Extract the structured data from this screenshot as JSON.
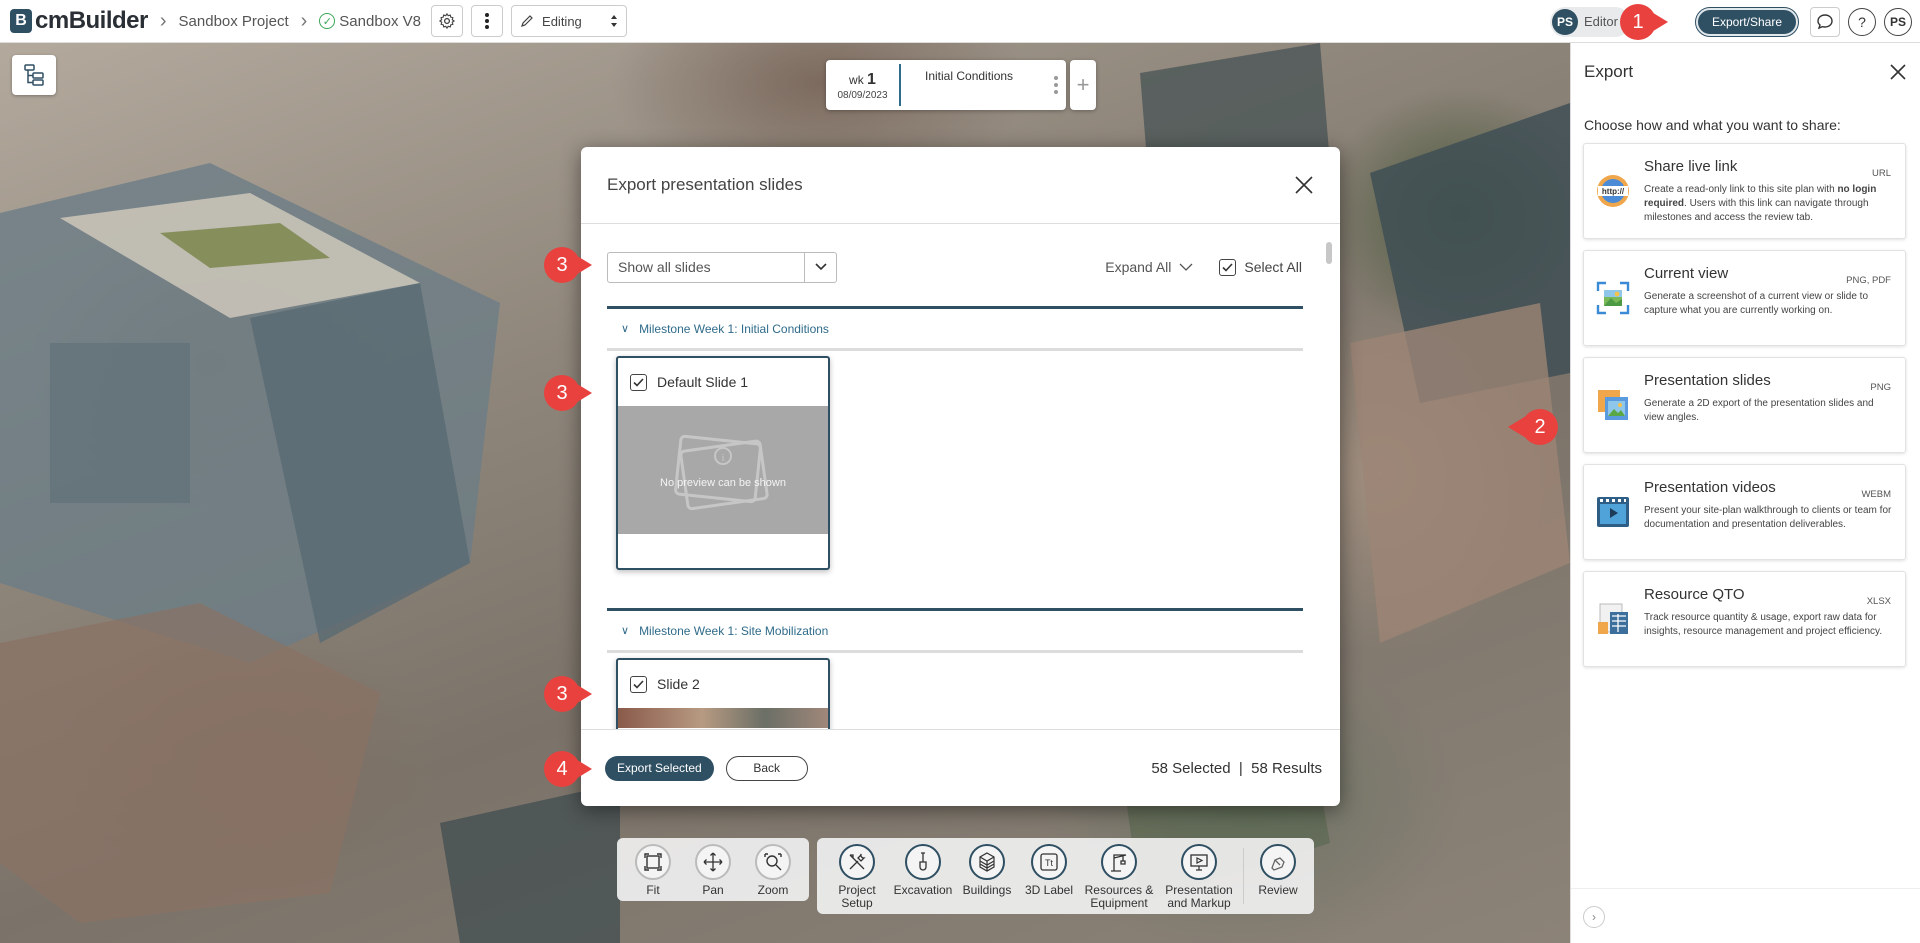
{
  "topbar": {
    "logo_letter": "B",
    "logo_text": "cmBuilder",
    "breadcrumb_project": "Sandbox Project",
    "breadcrumb_version": "Sandbox V8",
    "mode": "Editing",
    "user_initials": "PS",
    "role": "Editor",
    "export_label": "Export/Share",
    "help_glyph": "?",
    "profile_initials": "PS"
  },
  "milestone": {
    "wk_label": "wk",
    "wk_number": "1",
    "date": "08/09/2023",
    "name": "Initial Conditions",
    "add_glyph": "+"
  },
  "markers": [
    "1",
    "2",
    "3",
    "3",
    "3",
    "4"
  ],
  "modal": {
    "title": "Export presentation slides",
    "filter_value": "Show all slides",
    "expand_all": "Expand All",
    "select_all": "Select All",
    "groups": [
      {
        "title": "Milestone Week 1: Initial Conditions",
        "slide_title": "Default Slide 1",
        "preview_text": "No preview can be shown"
      },
      {
        "title": "Milestone Week 1: Site Mobilization",
        "slide_title": "Slide 2"
      }
    ],
    "export_selected": "Export Selected",
    "back": "Back",
    "selection_summary": "58 Selected  |  58 Results"
  },
  "panel": {
    "title": "Export",
    "subtitle": "Choose how and what you want to share:",
    "options": [
      {
        "title": "Share live link",
        "tag": "URL",
        "desc_pre": "Create a read-only link to this site plan with ",
        "desc_bold": "no login required",
        "desc_post": ". Users with this link can navigate through milestones and access the review tab.",
        "icon": "http-link-icon",
        "icon_text": "http://"
      },
      {
        "title": "Current view",
        "tag": "PNG, PDF",
        "desc": "Generate a screenshot of a current view or slide to capture what you are currently working on.",
        "icon": "screenshot-icon"
      },
      {
        "title": "Presentation slides",
        "tag": "PNG",
        "desc": "Generate a 2D export of the presentation slides and view angles.",
        "icon": "slides-icon"
      },
      {
        "title": "Presentation videos",
        "tag": "WEBM",
        "desc": "Present your site-plan walkthrough to clients or team for documentation and presentation deliverables.",
        "icon": "video-icon"
      },
      {
        "title": "Resource QTO",
        "tag": "XLSX",
        "desc": "Track resource quantity & usage, export raw data for insights, resource management and project efficiency.",
        "icon": "spreadsheet-icon"
      }
    ]
  },
  "toolbar": {
    "view_tools": [
      "Fit",
      "Pan",
      "Zoom"
    ],
    "edit_tools": [
      "Project Setup",
      "Excavation",
      "Buildings",
      "3D Label",
      "Resources & Equipment",
      "Presentation and Markup"
    ],
    "review": "Review"
  },
  "colors": {
    "brand": "#2f4f63",
    "marker": "#e8413e",
    "link": "#2f6b8a"
  }
}
